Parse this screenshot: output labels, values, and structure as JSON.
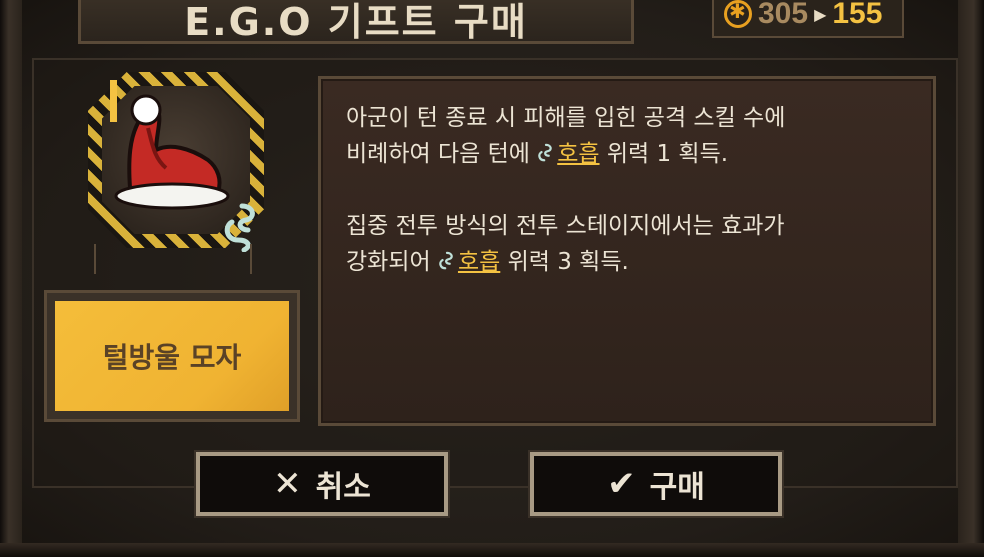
{
  "title": "E.G.O 기프트 구매",
  "currency": {
    "icon": "cost-coin-icon",
    "before": "305",
    "after": "155",
    "color_before": "#a88a60",
    "color_after": "#f4c242"
  },
  "item": {
    "name": "털방울 모자",
    "icon": "santa-hat-icon",
    "keyword_icon": "breath-icon"
  },
  "description": {
    "line1": "아군이 턴 종료 시 피해를 입힌 공격 스킬 수에",
    "line2_pre": "비례하여 다음 턴에 ",
    "line2_keyword": "호흡",
    "line2_post": " 위력 1 획득.",
    "line3": "집중 전투 방식의 전투 스테이지에서는 효과가",
    "line4_pre": "강화되어 ",
    "line4_keyword": "호흡",
    "line4_post": " 위력 3 획득."
  },
  "buttons": {
    "cancel_label": "취소",
    "cancel_icon": "close-icon",
    "buy_label": "구매",
    "buy_icon": "check-icon"
  },
  "colors": {
    "accent": "#f4c242",
    "name_plate": "#f4bd3a",
    "panel": "#2e221b"
  }
}
